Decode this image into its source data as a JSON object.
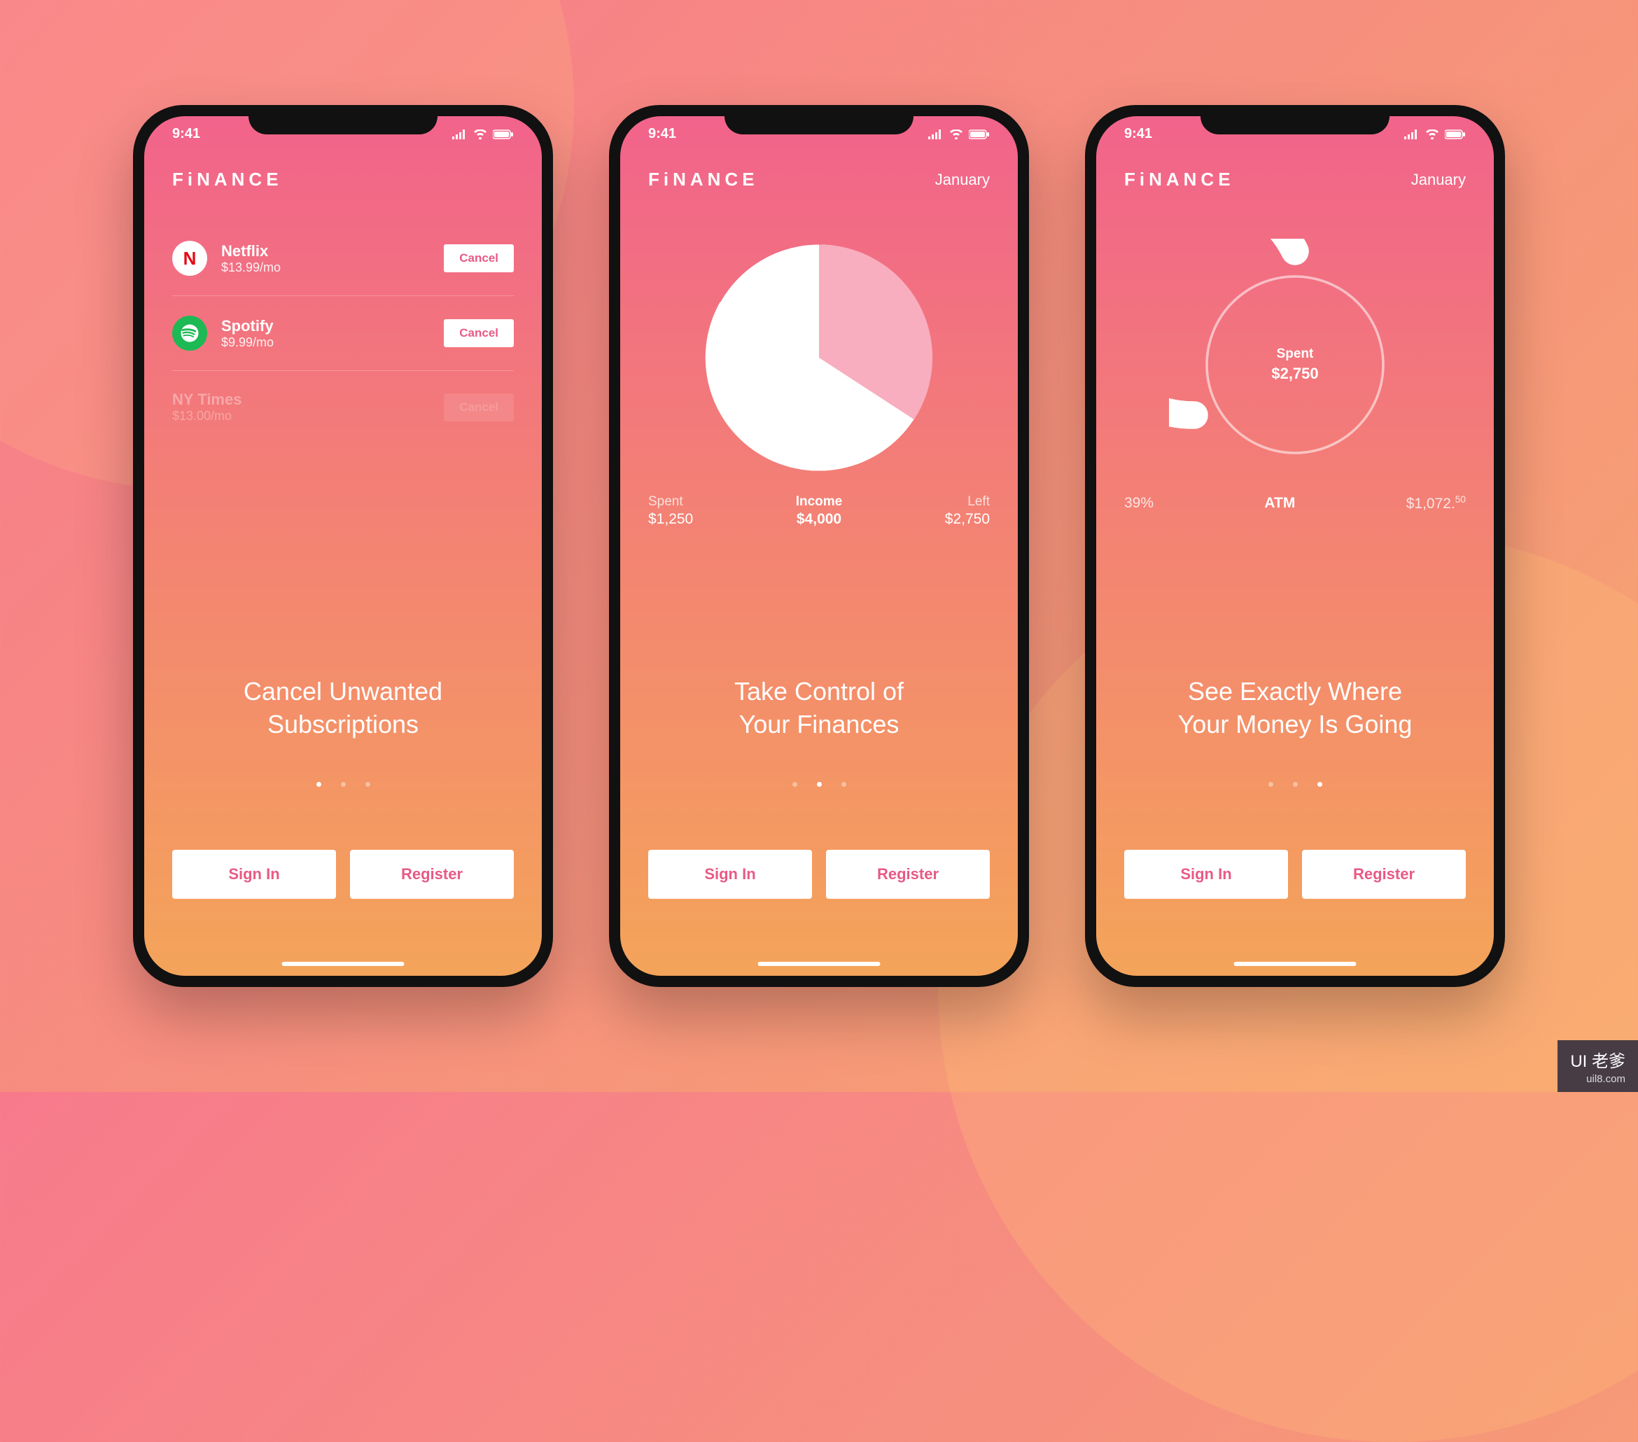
{
  "status_time": "9:41",
  "brand": "FiNANCE",
  "month": "January",
  "screens": [
    {
      "subscriptions": [
        {
          "name": "Netflix",
          "price": "$13.99/mo",
          "cancel": "Cancel",
          "icon": "N"
        },
        {
          "name": "Spotify",
          "price": "$9.99/mo",
          "cancel": "Cancel",
          "icon": "♫"
        },
        {
          "name": "NY Times",
          "price": "$13.00/mo",
          "cancel": "Cancel",
          "faded": true
        }
      ],
      "headline_l1": "Cancel Unwanted",
      "headline_l2": "Subscriptions",
      "active_dot": 0
    },
    {
      "stats": {
        "spent_label": "Spent",
        "spent_value": "$1,250",
        "income_label": "Income",
        "income_value": "$4,000",
        "left_label": "Left",
        "left_value": "$2,750"
      },
      "headline_l1": "Take Control of",
      "headline_l2": "Your Finances",
      "active_dot": 1
    },
    {
      "gauge": {
        "label": "Spent",
        "value": "$2,750"
      },
      "row": {
        "percent": "39%",
        "mid": "ATM",
        "amount": "$1,072.",
        "amount_cents": "50"
      },
      "headline_l1": "See Exactly Where",
      "headline_l2": "Your Money Is Going",
      "active_dot": 2
    }
  ],
  "cta": {
    "signin": "Sign In",
    "register": "Register"
  },
  "chart_data": [
    {
      "type": "pie",
      "title": "Income breakdown",
      "series": [
        {
          "name": "Spent",
          "value": 1250
        },
        {
          "name": "Left",
          "value": 2750
        }
      ],
      "total_label": "Income",
      "total": 4000
    },
    {
      "type": "gauge",
      "title": "Spending progress",
      "value": 2750,
      "max": 4000,
      "percent": 0.6875,
      "label": "Spent"
    }
  ],
  "watermark": {
    "top": "UI 老爹",
    "bottom": "uil8.com"
  }
}
